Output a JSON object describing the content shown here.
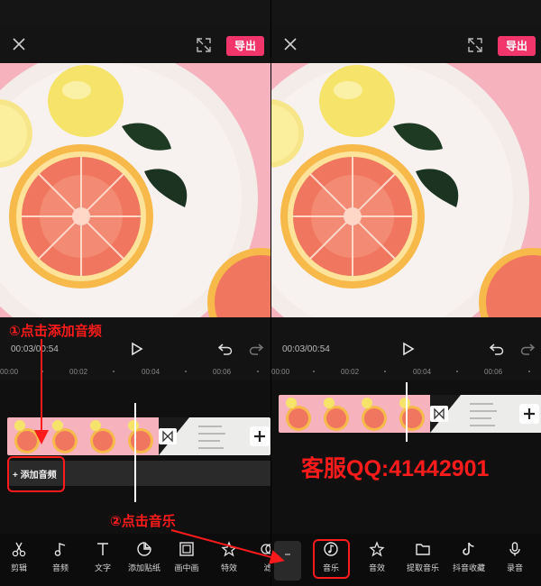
{
  "left_panel": {
    "export_label": "导出",
    "timecode": "00:03/00:54",
    "ticks": [
      "00:00",
      "00:02",
      "00:04",
      "00:06"
    ],
    "add_audio_label": "+ 添加音频",
    "tools": [
      {
        "label": "剪辑",
        "icon": "scissors-icon"
      },
      {
        "label": "音频",
        "icon": "music-note-icon"
      },
      {
        "label": "文字",
        "icon": "text-icon"
      },
      {
        "label": "添加贴纸",
        "icon": "sticker-icon"
      },
      {
        "label": "画中画",
        "icon": "picture-in-picture-icon"
      },
      {
        "label": "特效",
        "icon": "effects-star-icon"
      },
      {
        "label": "滤",
        "icon": "filter-icon"
      }
    ]
  },
  "right_panel": {
    "export_label": "导出",
    "timecode": "00:03/00:54",
    "ticks": [
      "00:00",
      "00:02",
      "00:04",
      "00:06"
    ],
    "tools": [
      {
        "label": "音乐",
        "icon": "music-disc-icon"
      },
      {
        "label": "音效",
        "icon": "sound-effect-icon"
      },
      {
        "label": "提取音乐",
        "icon": "folder-icon"
      },
      {
        "label": "抖音收藏",
        "icon": "douyin-icon"
      },
      {
        "label": "录音",
        "icon": "microphone-icon"
      }
    ]
  },
  "annotations": {
    "step1": "①点击添加音频",
    "step2": "②点击音乐",
    "qq": "客服QQ:41442901"
  },
  "colors": {
    "accent": "#f2366b",
    "annotation_red": "#ff1b1b",
    "preview_bg": "#f6b3be"
  }
}
